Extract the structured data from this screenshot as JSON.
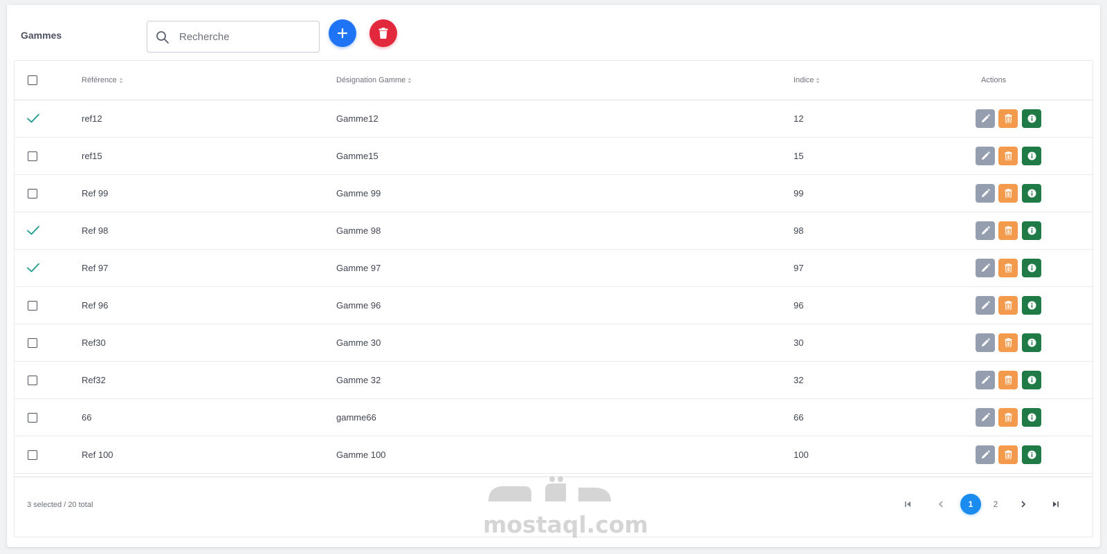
{
  "header": {
    "title": "Gammes",
    "search_placeholder": "Recherche",
    "search_value": ""
  },
  "table": {
    "columns": [
      "Référence",
      "Désignation Gamme",
      "Indice",
      "Actions"
    ],
    "rows": [
      {
        "selected": true,
        "reference": "ref12",
        "designation": "Gamme12",
        "indice": "12"
      },
      {
        "selected": false,
        "reference": "ref15",
        "designation": "Gamme15",
        "indice": "15"
      },
      {
        "selected": false,
        "reference": "Ref 99",
        "designation": "Gamme 99",
        "indice": "99"
      },
      {
        "selected": true,
        "reference": "Ref 98",
        "designation": "Gamme 98",
        "indice": "98"
      },
      {
        "selected": true,
        "reference": "Ref 97",
        "designation": "Gamme 97",
        "indice": "97"
      },
      {
        "selected": false,
        "reference": "Ref 96",
        "designation": "Gamme 96",
        "indice": "96"
      },
      {
        "selected": false,
        "reference": "Ref30",
        "designation": "Gamme 30",
        "indice": "30"
      },
      {
        "selected": false,
        "reference": "Ref32",
        "designation": "Gamme 32",
        "indice": "32"
      },
      {
        "selected": false,
        "reference": "66",
        "designation": "gamme66",
        "indice": "66"
      },
      {
        "selected": false,
        "reference": "Ref 100",
        "designation": "Gamme 100",
        "indice": "100"
      }
    ],
    "row_actions": [
      "edit-icon",
      "trash-icon",
      "info-icon"
    ]
  },
  "footer": {
    "status": "3 selected / 20 total",
    "pages": [
      "1",
      "2"
    ],
    "current_page": "1"
  },
  "watermark": {
    "arabic": "مستقل",
    "latin": "mostaql.com"
  },
  "colors": {
    "add": "#1f74f5",
    "delete": "#e2283c",
    "edit": "#949eae",
    "row_delete": "#f39a4c",
    "info": "#1f7a45",
    "check": "#1a9a8a",
    "page_active": "#1a8cf0"
  }
}
